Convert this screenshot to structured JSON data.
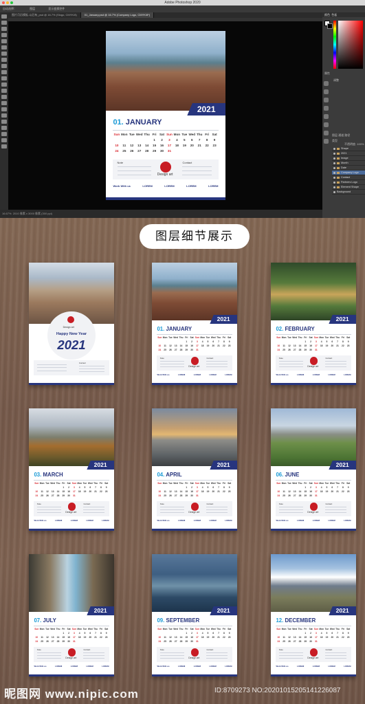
{
  "app": {
    "title": "Adobe Photoshop 2020"
  },
  "options": [
    "自动选择：",
    "图层",
    "显示变换控件"
  ],
  "tabs": [
    "图片月历模板-以后有_psd @ 16.7% (Slogo, CMYK/8)",
    "01_January.psd @ 16.7% (Company Logo, CMYK/8*)"
  ],
  "status": {
    "zoom": "16.67%",
    "doc": "2010 像素 x 3000 像素 (300 ppi)"
  },
  "panels": {
    "color": "颜色",
    "swatches": "色板",
    "properties": "属性",
    "adjust": "调整",
    "layers_tab": "图层",
    "channels": "通道",
    "paths": "路径",
    "kind": "类型",
    "opacity": "不透明度: 100%",
    "fill": "填充: 100%"
  },
  "layers": [
    "Shape",
    "2021",
    "Image",
    "Month",
    "Date",
    "Company Logo",
    "Contact",
    "Partners Logo",
    "Element Shape",
    "Background"
  ],
  "banner": "图层细节展示",
  "watermark": {
    "site": "昵图网 www.nipic.com",
    "id": "ID:8709273 NO:20201015205141226087"
  },
  "calendar": {
    "year": "2021",
    "days": [
      "Sun",
      "Mon",
      "Tue",
      "Wed",
      "Thu",
      "Fri",
      "Sat",
      "Sun",
      "Mon",
      "Tue",
      "Wed",
      "Thu",
      "Fri",
      "Sat"
    ],
    "dates": [
      "",
      "",
      "",
      "",
      "",
      "1",
      "2",
      "3",
      "4",
      "5",
      "6",
      "7",
      "8",
      "9",
      "10",
      "11",
      "12",
      "13",
      "14",
      "15",
      "16",
      "17",
      "18",
      "19",
      "20",
      "21",
      "22",
      "23",
      "24",
      "25",
      "26",
      "27",
      "28",
      "29",
      "30",
      "31"
    ],
    "note": "Note",
    "brand": "Design art",
    "contact": "Contact",
    "work": "Work With us",
    "partner": "LOREM",
    "cover_title": "Happy New Year",
    "months": [
      {
        "num": "01.",
        "name": "JANUARY"
      },
      {
        "num": "02.",
        "name": "FEBRUARY"
      },
      {
        "num": "03.",
        "name": "MARCH"
      },
      {
        "num": "04.",
        "name": "APRIL"
      },
      {
        "num": "06.",
        "name": "JUNE"
      },
      {
        "num": "07.",
        "name": "JULY"
      },
      {
        "num": "09.",
        "name": "SEPTEMBER"
      },
      {
        "num": "12.",
        "name": "DECEMBER"
      }
    ]
  }
}
